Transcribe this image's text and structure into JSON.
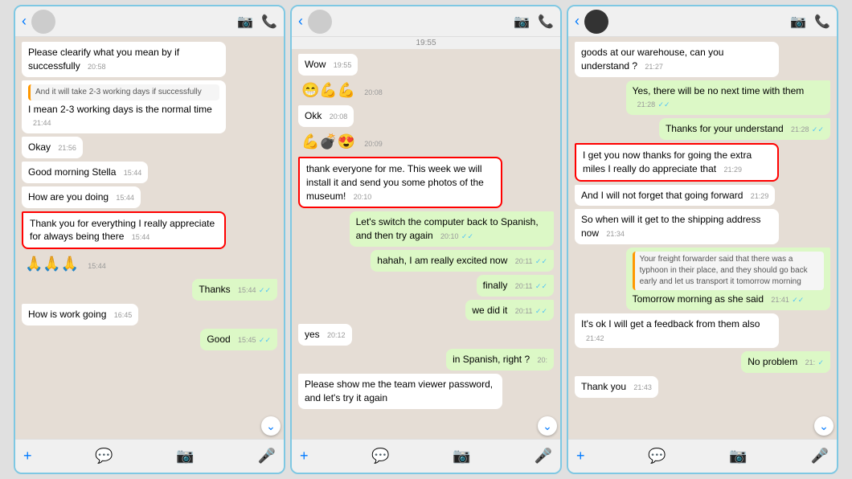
{
  "panel1": {
    "messages": [
      {
        "type": "received",
        "text": "Please clearify what you mean by if successfully",
        "time": "20:58",
        "highlight": false
      },
      {
        "type": "received",
        "quoted": "And it will take 2-3 working days if successfully",
        "text": "I mean 2-3 working days is the normal time",
        "time": "21:44",
        "highlight": false
      },
      {
        "type": "received",
        "text": "Okay",
        "time": "21:56",
        "highlight": false
      },
      {
        "type": "received",
        "text": "Good morning Stella",
        "time": "15:44",
        "highlight": false
      },
      {
        "type": "received",
        "text": "How are you doing",
        "time": "15:44",
        "highlight": false
      },
      {
        "type": "received",
        "text": "Thank you for everything I really appreciate for always being there",
        "time": "15:44",
        "highlight": true
      },
      {
        "type": "received",
        "emoji": "🙏🙏🙏",
        "time": "15:44",
        "highlight": false
      },
      {
        "type": "sent",
        "text": "Thanks",
        "time": "15:44",
        "ticks": "✓✓",
        "highlight": false
      },
      {
        "type": "received",
        "text": "How is work going",
        "time": "16:45",
        "highlight": false
      },
      {
        "type": "sent",
        "text": "Good",
        "time": "15:45",
        "ticks": "✓✓",
        "highlight": false
      }
    ],
    "footer": {
      "plus": "+",
      "icons": [
        "💬",
        "📷",
        "🎤"
      ]
    }
  },
  "panel2": {
    "time_bar": "19:55",
    "messages": [
      {
        "type": "received",
        "text": "Wow",
        "time": "19:55",
        "highlight": false
      },
      {
        "type": "received",
        "emoji": "😁💪💪",
        "time": "20:08",
        "highlight": false
      },
      {
        "type": "received",
        "text": "Okk",
        "time": "20:08",
        "highlight": false
      },
      {
        "type": "received",
        "emoji": "💪💣😍",
        "time": "20:09",
        "highlight": false
      },
      {
        "type": "received",
        "text": "thank everyone for me. This week we will install it and send you some photos of the museum!",
        "time": "20:10",
        "highlight": true
      },
      {
        "type": "sent",
        "text": "Let's switch the computer back to Spanish, and then try again",
        "time": "20:10",
        "ticks": "✓✓",
        "highlight": false
      },
      {
        "type": "sent",
        "text": "hahah, I am really excited now",
        "time": "20:11",
        "ticks": "✓✓",
        "highlight": false
      },
      {
        "type": "sent",
        "text": "finally",
        "time": "20:11",
        "ticks": "✓✓",
        "highlight": false
      },
      {
        "type": "sent",
        "text": "we did it",
        "time": "20:11",
        "ticks": "✓✓",
        "highlight": false
      },
      {
        "type": "received",
        "text": "yes",
        "time": "20:12",
        "highlight": false
      },
      {
        "type": "sent",
        "text": "in Spanish, right ?",
        "time": "20:",
        "ticks": "",
        "highlight": false
      },
      {
        "type": "received",
        "text": "Please show me the team viewer password, and let's try it again",
        "time": "",
        "highlight": false
      }
    ],
    "footer": {
      "plus": "+",
      "icons": [
        "💬",
        "📷",
        "🎤"
      ]
    }
  },
  "panel3": {
    "messages": [
      {
        "type": "received",
        "text": "goods at our warehouse, can you understand ?",
        "time": "21:27",
        "highlight": false
      },
      {
        "type": "sent",
        "text": "Yes, there will be no next time with them",
        "time": "21:28",
        "ticks": "✓✓",
        "highlight": false
      },
      {
        "type": "sent",
        "text": "Thanks for your understand",
        "time": "21:28",
        "ticks": "✓✓",
        "highlight": false
      },
      {
        "type": "received",
        "text": "I get you now thanks for going the extra miles I really do appreciate that",
        "time": "21:29",
        "highlight": true
      },
      {
        "type": "received",
        "text": "And I will not forget that going forward",
        "time": "21:29",
        "highlight": false
      },
      {
        "type": "received",
        "text": "So when will it get to the shipping address now",
        "time": "21:34",
        "highlight": false
      },
      {
        "type": "received",
        "quoted": "Your freight forwarder said that there was a typhoon in their place, and they should go back early and let us transport it tomorrow morning",
        "text": "Tomorrow morning as she said",
        "time": "21:41",
        "ticks": "✓✓",
        "highlight": false
      },
      {
        "type": "received",
        "text": "It's ok I will get a feedback from them also",
        "time": "21:42",
        "highlight": false
      },
      {
        "type": "sent",
        "text": "No problem",
        "time": "21:",
        "ticks": "✓",
        "highlight": false
      },
      {
        "type": "received",
        "text": "Thank you",
        "time": "21:43",
        "highlight": false
      }
    ],
    "footer": {
      "plus": "+",
      "icons": [
        "💬",
        "📷",
        "🎤"
      ]
    }
  }
}
